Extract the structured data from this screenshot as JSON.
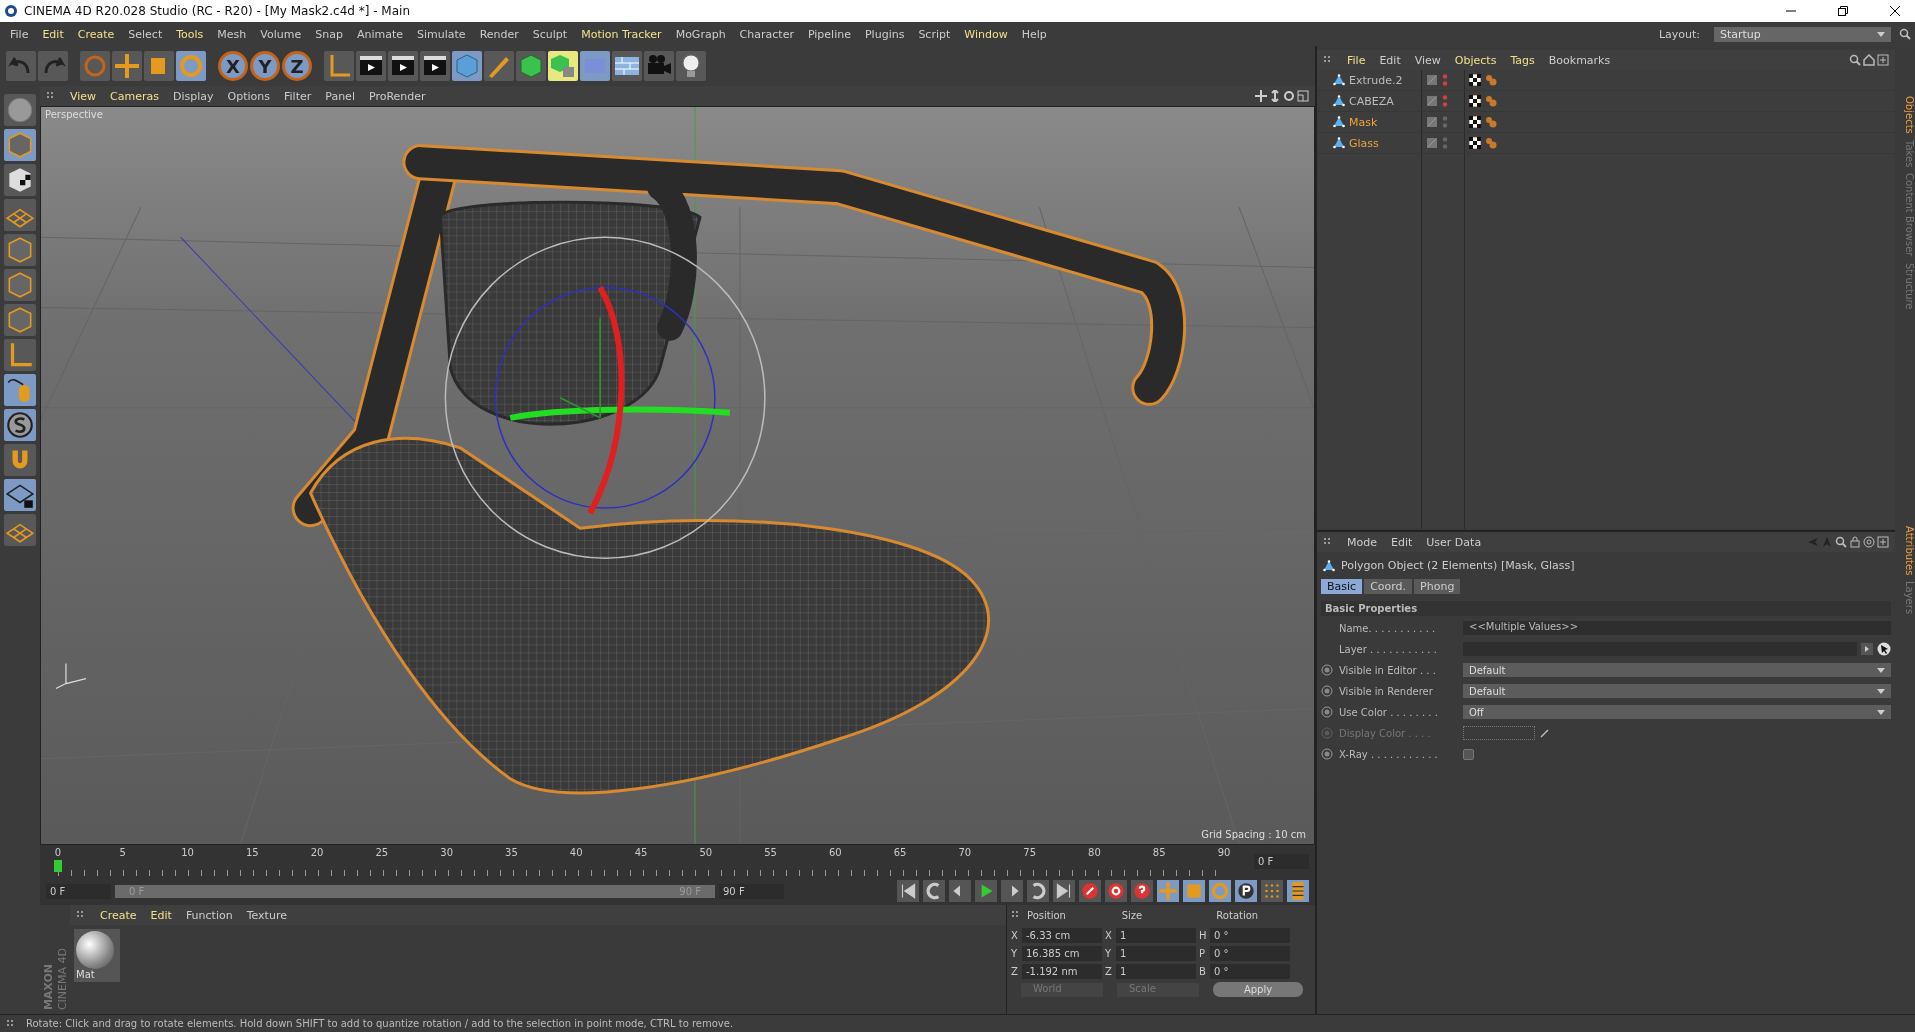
{
  "window": {
    "title": "CINEMA 4D R20.028 Studio (RC - R20) - [My Mask2.c4d *] - Main"
  },
  "menu": [
    {
      "label": "File",
      "highlighted": false
    },
    {
      "label": "Edit",
      "highlighted": true
    },
    {
      "label": "Create",
      "highlighted": true
    },
    {
      "label": "Select",
      "highlighted": false
    },
    {
      "label": "Tools",
      "highlighted": true
    },
    {
      "label": "Mesh",
      "highlighted": false
    },
    {
      "label": "Volume",
      "highlighted": false
    },
    {
      "label": "Snap",
      "highlighted": false
    },
    {
      "label": "Animate",
      "highlighted": false
    },
    {
      "label": "Simulate",
      "highlighted": false
    },
    {
      "label": "Render",
      "highlighted": false
    },
    {
      "label": "Sculpt",
      "highlighted": false
    },
    {
      "label": "Motion Tracker",
      "highlighted": true
    },
    {
      "label": "MoGraph",
      "highlighted": false
    },
    {
      "label": "Character",
      "highlighted": false
    },
    {
      "label": "Pipeline",
      "highlighted": false
    },
    {
      "label": "Plugins",
      "highlighted": false
    },
    {
      "label": "Script",
      "highlighted": false
    },
    {
      "label": "Window",
      "highlighted": true
    },
    {
      "label": "Help",
      "highlighted": false
    }
  ],
  "layout": {
    "label": "Layout:",
    "value": "Startup"
  },
  "toolbar": {
    "axis_buttons": [
      "X",
      "Y",
      "Z"
    ]
  },
  "viewport": {
    "menu": [
      {
        "label": "View",
        "highlighted": true
      },
      {
        "label": "Cameras",
        "highlighted": true
      },
      {
        "label": "Display",
        "highlighted": false
      },
      {
        "label": "Options",
        "highlighted": false
      },
      {
        "label": "Filter",
        "highlighted": false
      },
      {
        "label": "Panel",
        "highlighted": false
      },
      {
        "label": "ProRender",
        "highlighted": false
      }
    ],
    "camera": "Perspective",
    "grid_spacing": "Grid Spacing : 10 cm"
  },
  "objects": {
    "menu": [
      {
        "label": "File",
        "highlighted": true
      },
      {
        "label": "Edit",
        "highlighted": false
      },
      {
        "label": "View",
        "highlighted": false
      },
      {
        "label": "Objects",
        "highlighted": true
      },
      {
        "label": "Tags",
        "highlighted": true
      },
      {
        "label": "Bookmarks",
        "highlighted": false
      }
    ],
    "rows": [
      {
        "name": "Extrude.2",
        "selected": false,
        "visible": false
      },
      {
        "name": "CABEZA",
        "selected": false,
        "visible": false
      },
      {
        "name": "Mask",
        "selected": true,
        "visible": true
      },
      {
        "name": "Glass",
        "selected": true,
        "visible": true
      }
    ]
  },
  "side_tabs_top": [
    {
      "label": "Objects",
      "selected": true
    },
    {
      "label": "Takes",
      "selected": false
    },
    {
      "label": "Content Browser",
      "selected": false
    },
    {
      "label": "Structure",
      "selected": false
    }
  ],
  "side_tabs_bottom": [
    {
      "label": "Attributes",
      "selected": true
    },
    {
      "label": "Layers",
      "selected": false
    }
  ],
  "attributes": {
    "menu": [
      "Mode",
      "Edit",
      "User Data"
    ],
    "title": "Polygon Object (2 Elements) [Mask, Glass]",
    "tabs": [
      {
        "label": "Basic",
        "selected": true
      },
      {
        "label": "Coord.",
        "selected": false
      },
      {
        "label": "Phong",
        "selected": false
      }
    ],
    "section": "Basic Properties",
    "properties": [
      {
        "kind": "text",
        "label": "Name. . . . . . . . . . .",
        "value": "<<Multiple Values>>",
        "keyframe": false,
        "disabled": false
      },
      {
        "kind": "layer",
        "label": "Layer . . . . . . . . . . .",
        "keyframe": false,
        "disabled": false
      },
      {
        "kind": "dropdown",
        "label": "Visible in Editor . . .",
        "value": "Default",
        "keyframe": true,
        "disabled": false
      },
      {
        "kind": "dropdown",
        "label": "Visible in Renderer",
        "value": "Default",
        "keyframe": true,
        "disabled": false
      },
      {
        "kind": "dropdown",
        "label": "Use Color . . . . . . . .",
        "value": "Off",
        "keyframe": true,
        "disabled": false
      },
      {
        "kind": "color",
        "label": "Display Color . . . .",
        "keyframe": true,
        "disabled": true
      },
      {
        "kind": "checkbox",
        "label": "X-Ray . . . . . . . . . . .",
        "keyframe": true,
        "disabled": false,
        "checked": false
      }
    ]
  },
  "timeline": {
    "ticks": [
      "0",
      "5",
      "10",
      "15",
      "20",
      "25",
      "30",
      "35",
      "40",
      "45",
      "50",
      "55",
      "60",
      "65",
      "70",
      "75",
      "80",
      "85",
      "90"
    ],
    "current": "0 F"
  },
  "transport": {
    "start": "0 F",
    "range_start": "0 F",
    "range_end": "90 F",
    "end": "90 F",
    "level": 1
  },
  "materials": {
    "menu": [
      {
        "label": "Create",
        "highlighted": true
      },
      {
        "label": "Edit",
        "highlighted": true
      },
      {
        "label": "Function",
        "highlighted": false
      },
      {
        "label": "Texture",
        "highlighted": false
      }
    ],
    "items": [
      "Mat"
    ]
  },
  "logo": {
    "brand": "MAXON",
    "product": "CINEMA 4D"
  },
  "coordinates": {
    "headers": [
      "Position",
      "Size",
      "Rotation"
    ],
    "rows": [
      {
        "axis": "X",
        "position": "-6.33 cm",
        "size_axis": "X",
        "size": "1",
        "rotation_axis": "H",
        "rotation": "0 °"
      },
      {
        "axis": "Y",
        "position": "16.385 cm",
        "size_axis": "Y",
        "size": "1",
        "rotation_axis": "P",
        "rotation": "0 °"
      },
      {
        "axis": "Z",
        "position": "-1.192 nm",
        "size_axis": "Z",
        "size": "1",
        "rotation_axis": "B",
        "rotation": "0 °"
      }
    ],
    "space": "World",
    "mode": "Scale",
    "apply": "Apply"
  },
  "status_bar": "Rotate: Click and drag to rotate elements. Hold down SHIFT to add to quantize rotation / add to the selection in point mode, CTRL to remove."
}
